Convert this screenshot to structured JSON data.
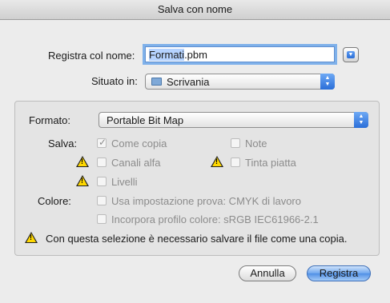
{
  "window": {
    "title": "Salva con nome"
  },
  "form": {
    "save_as_label": "Registra col nome:",
    "filename_selected": "Formati",
    "filename_ext": ".pbm",
    "location_label": "Situato in:",
    "location_value": "Scrivania"
  },
  "options": {
    "format_label": "Formato:",
    "format_value": "Portable Bit Map",
    "save_label": "Salva:",
    "as_copy": "Come copia",
    "notes": "Note",
    "alpha_channels": "Canali alfa",
    "spot_colors": "Tinta piatta",
    "layers": "Livelli",
    "color_label": "Colore:",
    "use_proof_setup": "Usa impostazione prova:  CMYK di lavoro",
    "embed_profile": "Incorpora profilo colore:  sRGB IEC61966-2.1",
    "warning_message": "Con questa selezione è necessario salvare il file come una copia."
  },
  "buttons": {
    "cancel": "Annulla",
    "save": "Registra"
  },
  "colors": {
    "accent": "#4f8fe6",
    "warning": "#ffd800"
  },
  "icons": [
    "disclosure-icon",
    "folder-icon",
    "popup-arrows-icon",
    "warning-icon",
    "checkmark-icon"
  ],
  "state": {
    "as_copy_checked": true
  }
}
